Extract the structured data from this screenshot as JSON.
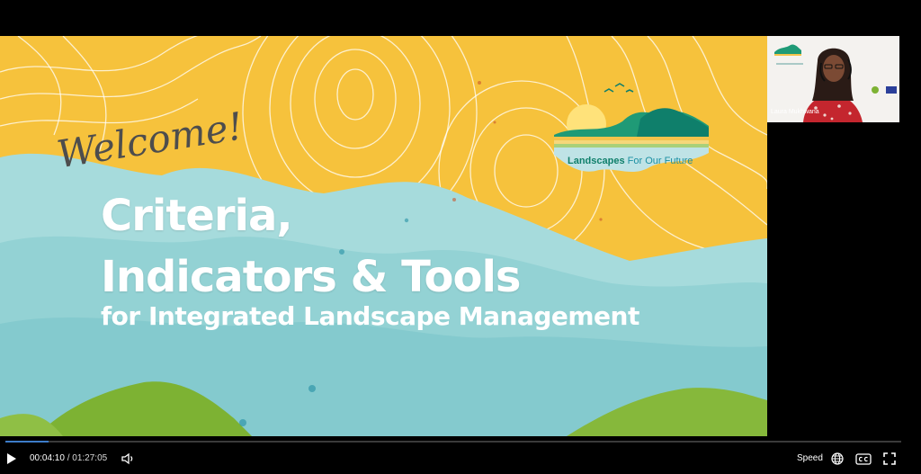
{
  "slide": {
    "welcome": "Welcome!",
    "title_line1": "Criteria,",
    "title_line2": "Indicators & Tools",
    "subtitle": "for Integrated Landscape Management",
    "logo_text_strong": "Landscapes",
    "logo_text_light": "For Our Future",
    "colors": {
      "sky": "#f6c23c",
      "mountain": "#a5dadd",
      "hill": "#7fb33a",
      "brand_green": "#0f7f6b"
    }
  },
  "speaker": {
    "name": "Laura Mukhwana"
  },
  "player": {
    "current_time": "00:04:10",
    "separator": "/",
    "duration": "01:27:05",
    "speed_label": "Speed",
    "progress_percent": 4.8,
    "icons": [
      "play-icon",
      "volume-icon",
      "globe-icon",
      "closed-captions-icon",
      "fullscreen-icon"
    ]
  }
}
